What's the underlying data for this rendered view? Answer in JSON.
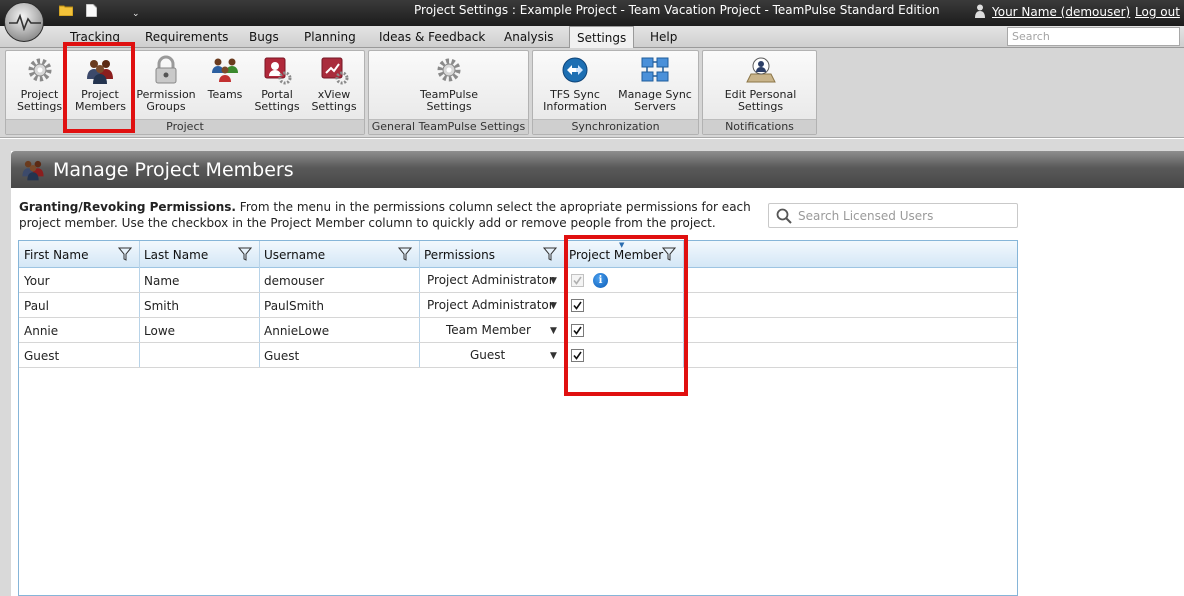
{
  "window": {
    "title": "Project Settings : Example Project - Team Vacation Project  - TeamPulse Standard Edition",
    "user_link": "Your Name (demouser)",
    "logout": "Log out"
  },
  "tabs": [
    {
      "label": "Tracking"
    },
    {
      "label": "Requirements"
    },
    {
      "label": "Bugs"
    },
    {
      "label": "Planning"
    },
    {
      "label": "Ideas & Feedback"
    },
    {
      "label": "Analysis"
    },
    {
      "label": "Settings",
      "active": true
    },
    {
      "label": "Help"
    }
  ],
  "search": {
    "placeholder": "Search"
  },
  "ribbon": {
    "groups": [
      {
        "label": "Project",
        "buttons": [
          {
            "label": "Project Settings",
            "icon": "gear-icon"
          },
          {
            "label": "Project Members",
            "icon": "people-icon"
          },
          {
            "label": "Permission Groups",
            "icon": "lock-icon"
          },
          {
            "label": "Teams",
            "icon": "team-icon"
          },
          {
            "label": "Portal Settings",
            "icon": "portal-icon"
          },
          {
            "label": "xView Settings",
            "icon": "xview-icon"
          }
        ]
      },
      {
        "label": "General TeamPulse Settings",
        "buttons": [
          {
            "label": "TeamPulse Settings",
            "icon": "gear-icon"
          }
        ]
      },
      {
        "label": "Synchronization",
        "buttons": [
          {
            "label": "TFS Sync Information",
            "icon": "sync-icon"
          },
          {
            "label": "Manage Sync Servers",
            "icon": "servers-icon"
          }
        ]
      },
      {
        "label": "Notifications",
        "buttons": [
          {
            "label": "Edit Personal Settings",
            "icon": "personal-settings-icon"
          }
        ]
      }
    ]
  },
  "page": {
    "title": "Manage Project Members",
    "desc_bold": "Granting/Revoking Permissions.",
    "desc_text": " From the menu in the permissions column select the apropriate permissions for each project member. Use the checkbox in the Project Member column to quickly add or remove people from the project.",
    "search_placeholder": "Search Licensed Users"
  },
  "grid": {
    "columns": [
      "First Name",
      "Last Name",
      "Username",
      "Permissions",
      "Project Member"
    ],
    "rows": [
      {
        "first": "Your",
        "last": "Name",
        "username": "demouser",
        "permission": "Project Administrator",
        "member": true,
        "disabled": true,
        "info": true
      },
      {
        "first": "Paul",
        "last": "Smith",
        "username": "PaulSmith",
        "permission": "Project Administrator",
        "member": true
      },
      {
        "first": "Annie",
        "last": "Lowe",
        "username": "AnnieLowe",
        "permission": "Team Member",
        "member": true
      },
      {
        "first": "Guest",
        "last": "",
        "username": "Guest",
        "permission": "Guest",
        "member": true
      }
    ]
  },
  "colors": {
    "highlight": "#e01010",
    "grid_border": "#86b5d8",
    "header_dark": "#474747"
  }
}
